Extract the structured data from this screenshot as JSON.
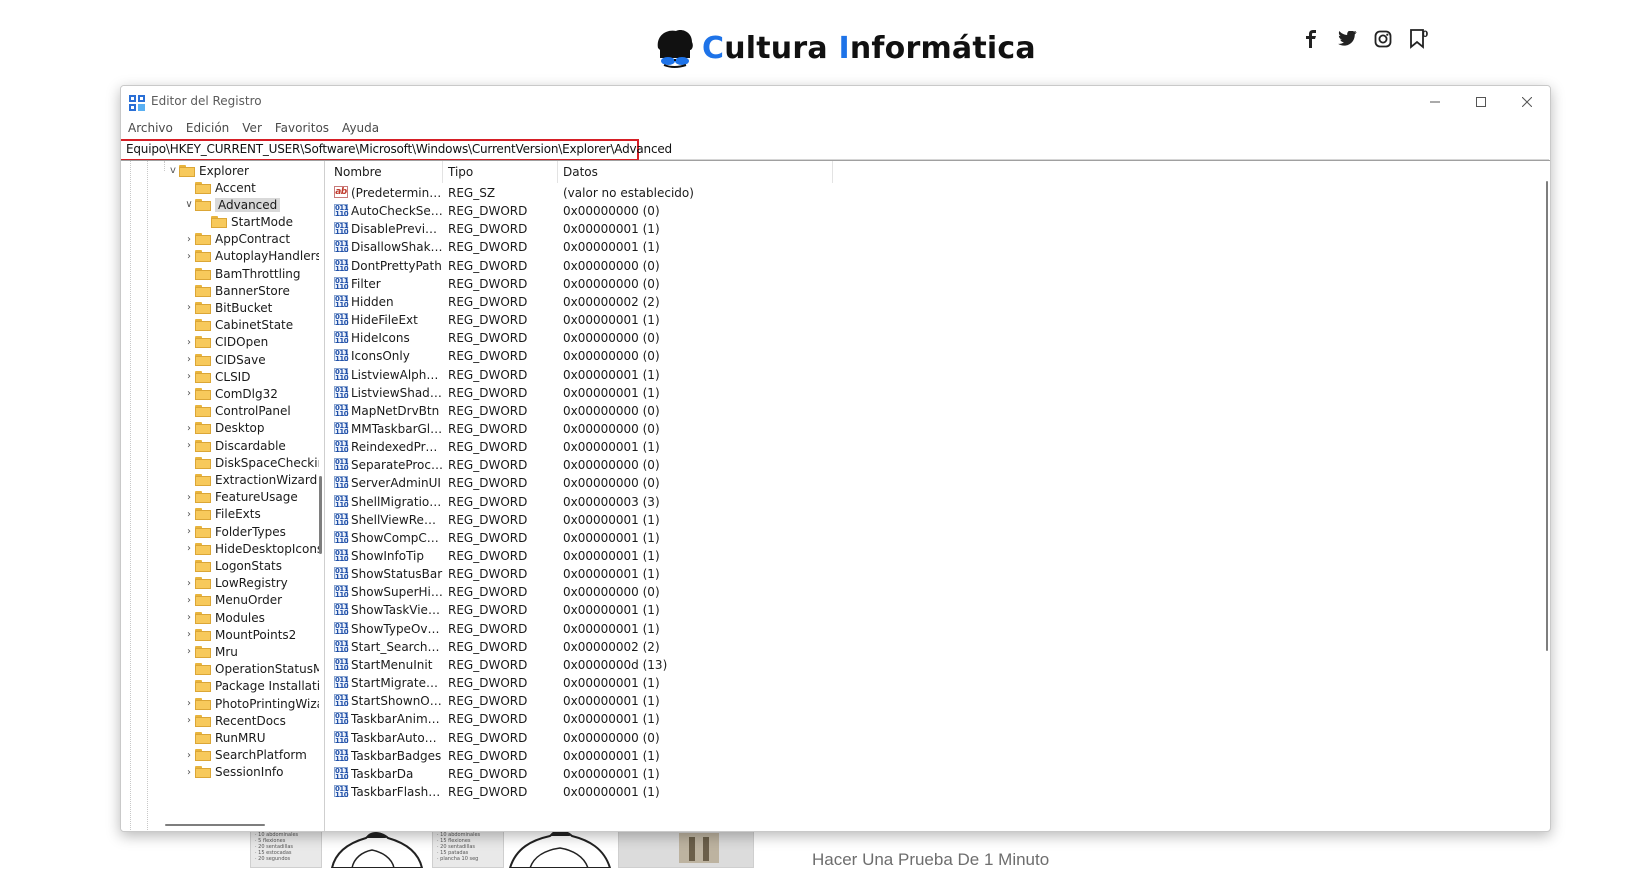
{
  "site": {
    "logo_first": "C",
    "logo_mid": "ultura ",
    "logo_second": "I",
    "logo_rest": "nformática",
    "social": [
      "facebook-icon",
      "twitter-icon",
      "instagram-icon",
      "bookmark-icon"
    ],
    "bookmark_count": "0",
    "promo_text": "Hacer Una Prueba De 1 Minuto",
    "accent_color": "#1e73e8"
  },
  "window": {
    "title": "Editor del Registro",
    "menu": [
      "Archivo",
      "Edición",
      "Ver",
      "Favoritos",
      "Ayuda"
    ],
    "address": "Equipo\\HKEY_CURRENT_USER\\Software\\Microsoft\\Windows\\CurrentVersion\\Explorer\\Advanced",
    "highlight_color": "#d61f26"
  },
  "tree": {
    "root": "Explorer",
    "items": [
      {
        "label": "Accent",
        "chevron": "",
        "level": 1
      },
      {
        "label": "Advanced",
        "chevron": "v",
        "level": 1,
        "selected": true
      },
      {
        "label": "StartMode",
        "chevron": "",
        "level": 2
      },
      {
        "label": "AppContract",
        "chevron": ">",
        "level": 1
      },
      {
        "label": "AutoplayHandlers",
        "chevron": ">",
        "level": 1
      },
      {
        "label": "BamThrottling",
        "chevron": "",
        "level": 1
      },
      {
        "label": "BannerStore",
        "chevron": "",
        "level": 1
      },
      {
        "label": "BitBucket",
        "chevron": ">",
        "level": 1
      },
      {
        "label": "CabinetState",
        "chevron": "",
        "level": 1
      },
      {
        "label": "CIDOpen",
        "chevron": ">",
        "level": 1
      },
      {
        "label": "CIDSave",
        "chevron": ">",
        "level": 1
      },
      {
        "label": "CLSID",
        "chevron": ">",
        "level": 1
      },
      {
        "label": "ComDlg32",
        "chevron": ">",
        "level": 1
      },
      {
        "label": "ControlPanel",
        "chevron": "",
        "level": 1
      },
      {
        "label": "Desktop",
        "chevron": ">",
        "level": 1
      },
      {
        "label": "Discardable",
        "chevron": ">",
        "level": 1
      },
      {
        "label": "DiskSpaceChecking",
        "chevron": "",
        "level": 1
      },
      {
        "label": "ExtractionWizard",
        "chevron": "",
        "level": 1
      },
      {
        "label": "FeatureUsage",
        "chevron": ">",
        "level": 1
      },
      {
        "label": "FileExts",
        "chevron": ">",
        "level": 1
      },
      {
        "label": "FolderTypes",
        "chevron": ">",
        "level": 1
      },
      {
        "label": "HideDesktopIcons",
        "chevron": ">",
        "level": 1
      },
      {
        "label": "LogonStats",
        "chevron": "",
        "level": 1
      },
      {
        "label": "LowRegistry",
        "chevron": ">",
        "level": 1
      },
      {
        "label": "MenuOrder",
        "chevron": ">",
        "level": 1
      },
      {
        "label": "Modules",
        "chevron": ">",
        "level": 1
      },
      {
        "label": "MountPoints2",
        "chevron": ">",
        "level": 1
      },
      {
        "label": "Mru",
        "chevron": ">",
        "level": 1
      },
      {
        "label": "OperationStatusMessages",
        "chevron": "",
        "level": 1
      },
      {
        "label": "Package Installation",
        "chevron": "",
        "level": 1
      },
      {
        "label": "PhotoPrintingWizard",
        "chevron": ">",
        "level": 1
      },
      {
        "label": "RecentDocs",
        "chevron": ">",
        "level": 1
      },
      {
        "label": "RunMRU",
        "chevron": "",
        "level": 1
      },
      {
        "label": "SearchPlatform",
        "chevron": ">",
        "level": 1
      },
      {
        "label": "SessionInfo",
        "chevron": ">",
        "level": 1
      }
    ]
  },
  "list": {
    "columns": [
      "Nombre",
      "Tipo",
      "Datos"
    ],
    "rows": [
      {
        "name": "(Predeterminado)",
        "type": "REG_SZ",
        "data": "(valor no establecido)",
        "kind": "str"
      },
      {
        "name": "AutoCheckSelect",
        "type": "REG_DWORD",
        "data": "0x00000000 (0)",
        "kind": "bin"
      },
      {
        "name": "DisablePreviewD...",
        "type": "REG_DWORD",
        "data": "0x00000001 (1)",
        "kind": "bin"
      },
      {
        "name": "DisallowShaking",
        "type": "REG_DWORD",
        "data": "0x00000001 (1)",
        "kind": "bin"
      },
      {
        "name": "DontPrettyPath",
        "type": "REG_DWORD",
        "data": "0x00000000 (0)",
        "kind": "bin"
      },
      {
        "name": "Filter",
        "type": "REG_DWORD",
        "data": "0x00000000 (0)",
        "kind": "bin"
      },
      {
        "name": "Hidden",
        "type": "REG_DWORD",
        "data": "0x00000002 (2)",
        "kind": "bin"
      },
      {
        "name": "HideFileExt",
        "type": "REG_DWORD",
        "data": "0x00000001 (1)",
        "kind": "bin"
      },
      {
        "name": "HideIcons",
        "type": "REG_DWORD",
        "data": "0x00000000 (0)",
        "kind": "bin"
      },
      {
        "name": "IconsOnly",
        "type": "REG_DWORD",
        "data": "0x00000000 (0)",
        "kind": "bin"
      },
      {
        "name": "ListviewAlphaSe...",
        "type": "REG_DWORD",
        "data": "0x00000001 (1)",
        "kind": "bin"
      },
      {
        "name": "ListviewShadow",
        "type": "REG_DWORD",
        "data": "0x00000001 (1)",
        "kind": "bin"
      },
      {
        "name": "MapNetDrvBtn",
        "type": "REG_DWORD",
        "data": "0x00000000 (0)",
        "kind": "bin"
      },
      {
        "name": "MMTaskbarGlo...",
        "type": "REG_DWORD",
        "data": "0x00000000 (0)",
        "kind": "bin"
      },
      {
        "name": "ReindexedProfile",
        "type": "REG_DWORD",
        "data": "0x00000001 (1)",
        "kind": "bin"
      },
      {
        "name": "SeparateProcess",
        "type": "REG_DWORD",
        "data": "0x00000000 (0)",
        "kind": "bin"
      },
      {
        "name": "ServerAdminUI",
        "type": "REG_DWORD",
        "data": "0x00000000 (0)",
        "kind": "bin"
      },
      {
        "name": "ShellMigrationL...",
        "type": "REG_DWORD",
        "data": "0x00000003 (3)",
        "kind": "bin"
      },
      {
        "name": "ShellViewReente...",
        "type": "REG_DWORD",
        "data": "0x00000001 (1)",
        "kind": "bin"
      },
      {
        "name": "ShowCompColor",
        "type": "REG_DWORD",
        "data": "0x00000001 (1)",
        "kind": "bin"
      },
      {
        "name": "ShowInfoTip",
        "type": "REG_DWORD",
        "data": "0x00000001 (1)",
        "kind": "bin"
      },
      {
        "name": "ShowStatusBar",
        "type": "REG_DWORD",
        "data": "0x00000001 (1)",
        "kind": "bin"
      },
      {
        "name": "ShowSuperHidd...",
        "type": "REG_DWORD",
        "data": "0x00000000 (0)",
        "kind": "bin"
      },
      {
        "name": "ShowTaskViewB...",
        "type": "REG_DWORD",
        "data": "0x00000001 (1)",
        "kind": "bin"
      },
      {
        "name": "ShowTypeOverlay",
        "type": "REG_DWORD",
        "data": "0x00000001 (1)",
        "kind": "bin"
      },
      {
        "name": "Start_SearchFiles",
        "type": "REG_DWORD",
        "data": "0x00000002 (2)",
        "kind": "bin"
      },
      {
        "name": "StartMenuInit",
        "type": "REG_DWORD",
        "data": "0x0000000d (13)",
        "kind": "bin"
      },
      {
        "name": "StartMigratedBr...",
        "type": "REG_DWORD",
        "data": "0x00000001 (1)",
        "kind": "bin"
      },
      {
        "name": "StartShownOnU...",
        "type": "REG_DWORD",
        "data": "0x00000001 (1)",
        "kind": "bin"
      },
      {
        "name": "TaskbarAnimati...",
        "type": "REG_DWORD",
        "data": "0x00000001 (1)",
        "kind": "bin"
      },
      {
        "name": "TaskbarAutoHid...",
        "type": "REG_DWORD",
        "data": "0x00000000 (0)",
        "kind": "bin"
      },
      {
        "name": "TaskbarBadges",
        "type": "REG_DWORD",
        "data": "0x00000001 (1)",
        "kind": "bin"
      },
      {
        "name": "TaskbarDa",
        "type": "REG_DWORD",
        "data": "0x00000001 (1)",
        "kind": "bin"
      },
      {
        "name": "TaskbarFlashing",
        "type": "REG_DWORD",
        "data": "0x00000001 (1)",
        "kind": "bin"
      }
    ]
  },
  "article": {
    "thumb_lines_a": [
      "· 10 abdominales",
      "· 5 flexiones",
      "· 20 sentadillas",
      "· 15 estocadas",
      "· 20 segundos"
    ],
    "thumb_lines_b": [
      "· 10 abdominales",
      "· 15 flexiones",
      "· 20 sentadillas",
      "· 15 patadas",
      "· plancha 10 seg"
    ]
  }
}
